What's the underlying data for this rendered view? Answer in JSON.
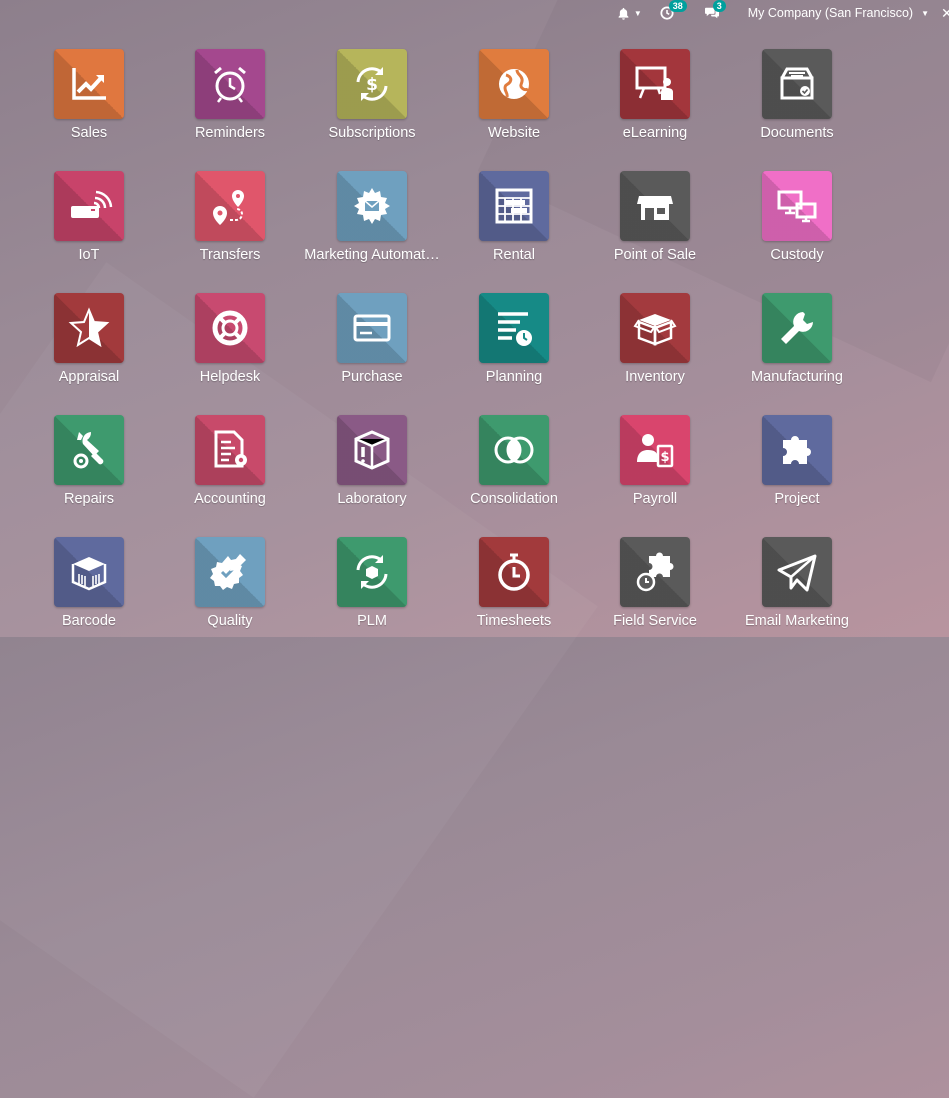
{
  "topbar": {
    "activity_badge": "38",
    "messages_badge": "3",
    "company": "My Company (San Francisco)"
  },
  "apps": [
    {
      "label": "Sales",
      "color": "#e0773f",
      "icon": "sales-chart-icon"
    },
    {
      "label": "Reminders",
      "color": "#a4488e",
      "icon": "alarm-clock-icon"
    },
    {
      "label": "Subscriptions",
      "color": "#b6b55b",
      "icon": "recurring-dollar-icon"
    },
    {
      "label": "Website",
      "color": "#e07c3e",
      "icon": "globe-icon"
    },
    {
      "label": "eLearning",
      "color": "#a3363c",
      "icon": "presentation-icon"
    },
    {
      "label": "Documents",
      "color": "#5a5a5a",
      "icon": "inbox-tray-icon"
    },
    {
      "label": "IoT",
      "color": "#c8436a",
      "icon": "wireless-device-icon"
    },
    {
      "label": "Transfers",
      "color": "#e0566b",
      "icon": "route-pins-icon"
    },
    {
      "label": "Marketing Automat…",
      "color": "#6fa0bf",
      "icon": "gear-envelope-icon"
    },
    {
      "label": "Rental",
      "color": "#5f6a9e",
      "icon": "calendar-grid-icon"
    },
    {
      "label": "Point of Sale",
      "color": "#5a5a5a",
      "icon": "shop-icon"
    },
    {
      "label": "Custody",
      "color": "#f06fc7",
      "icon": "monitors-icon"
    },
    {
      "label": "Appraisal",
      "color": "#a23a3c",
      "icon": "star-icon"
    },
    {
      "label": "Helpdesk",
      "color": "#c84a70",
      "icon": "lifebuoy-icon"
    },
    {
      "label": "Purchase",
      "color": "#6fa0bf",
      "icon": "credit-card-icon"
    },
    {
      "label": "Planning",
      "color": "#168a86",
      "icon": "planning-clock-icon"
    },
    {
      "label": "Inventory",
      "color": "#a33a3e",
      "icon": "open-box-icon"
    },
    {
      "label": "Manufacturing",
      "color": "#3e9a6e",
      "icon": "wrench-icon"
    },
    {
      "label": "Repairs",
      "color": "#3e9a6e",
      "icon": "wrench-gear-icon"
    },
    {
      "label": "Accounting",
      "color": "#c84a6a",
      "icon": "document-gear-icon"
    },
    {
      "label": "Laboratory",
      "color": "#8a5a86",
      "icon": "warning-box-icon"
    },
    {
      "label": "Consolidation",
      "color": "#3e9a6e",
      "icon": "overlap-circles-icon"
    },
    {
      "label": "Payroll",
      "color": "#d9456d",
      "icon": "employee-dollar-icon"
    },
    {
      "label": "Project",
      "color": "#5f6a9e",
      "icon": "puzzle-icon"
    },
    {
      "label": "Barcode",
      "color": "#5f6a9e",
      "icon": "barcode-box-icon"
    },
    {
      "label": "Quality",
      "color": "#6fa0bf",
      "icon": "quality-badge-icon"
    },
    {
      "label": "PLM",
      "color": "#3e9a6e",
      "icon": "cycle-box-icon"
    },
    {
      "label": "Timesheets",
      "color": "#a23a3c",
      "icon": "stopwatch-icon"
    },
    {
      "label": "Field Service",
      "color": "#5a5a5a",
      "icon": "puzzle-clock-icon"
    },
    {
      "label": "Email Marketing",
      "color": "#5a5a5a",
      "icon": "paper-plane-icon"
    }
  ]
}
